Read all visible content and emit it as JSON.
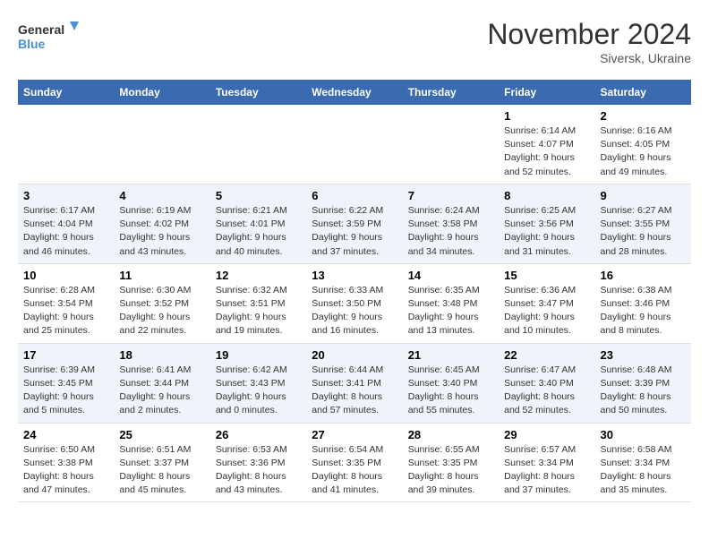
{
  "header": {
    "logo_line1": "General",
    "logo_line2": "Blue",
    "month_title": "November 2024",
    "location": "Siversk, Ukraine"
  },
  "weekdays": [
    "Sunday",
    "Monday",
    "Tuesday",
    "Wednesday",
    "Thursday",
    "Friday",
    "Saturday"
  ],
  "weeks": [
    [
      {
        "day": "",
        "info": ""
      },
      {
        "day": "",
        "info": ""
      },
      {
        "day": "",
        "info": ""
      },
      {
        "day": "",
        "info": ""
      },
      {
        "day": "",
        "info": ""
      },
      {
        "day": "1",
        "info": "Sunrise: 6:14 AM\nSunset: 4:07 PM\nDaylight: 9 hours\nand 52 minutes."
      },
      {
        "day": "2",
        "info": "Sunrise: 6:16 AM\nSunset: 4:05 PM\nDaylight: 9 hours\nand 49 minutes."
      }
    ],
    [
      {
        "day": "3",
        "info": "Sunrise: 6:17 AM\nSunset: 4:04 PM\nDaylight: 9 hours\nand 46 minutes."
      },
      {
        "day": "4",
        "info": "Sunrise: 6:19 AM\nSunset: 4:02 PM\nDaylight: 9 hours\nand 43 minutes."
      },
      {
        "day": "5",
        "info": "Sunrise: 6:21 AM\nSunset: 4:01 PM\nDaylight: 9 hours\nand 40 minutes."
      },
      {
        "day": "6",
        "info": "Sunrise: 6:22 AM\nSunset: 3:59 PM\nDaylight: 9 hours\nand 37 minutes."
      },
      {
        "day": "7",
        "info": "Sunrise: 6:24 AM\nSunset: 3:58 PM\nDaylight: 9 hours\nand 34 minutes."
      },
      {
        "day": "8",
        "info": "Sunrise: 6:25 AM\nSunset: 3:56 PM\nDaylight: 9 hours\nand 31 minutes."
      },
      {
        "day": "9",
        "info": "Sunrise: 6:27 AM\nSunset: 3:55 PM\nDaylight: 9 hours\nand 28 minutes."
      }
    ],
    [
      {
        "day": "10",
        "info": "Sunrise: 6:28 AM\nSunset: 3:54 PM\nDaylight: 9 hours\nand 25 minutes."
      },
      {
        "day": "11",
        "info": "Sunrise: 6:30 AM\nSunset: 3:52 PM\nDaylight: 9 hours\nand 22 minutes."
      },
      {
        "day": "12",
        "info": "Sunrise: 6:32 AM\nSunset: 3:51 PM\nDaylight: 9 hours\nand 19 minutes."
      },
      {
        "day": "13",
        "info": "Sunrise: 6:33 AM\nSunset: 3:50 PM\nDaylight: 9 hours\nand 16 minutes."
      },
      {
        "day": "14",
        "info": "Sunrise: 6:35 AM\nSunset: 3:48 PM\nDaylight: 9 hours\nand 13 minutes."
      },
      {
        "day": "15",
        "info": "Sunrise: 6:36 AM\nSunset: 3:47 PM\nDaylight: 9 hours\nand 10 minutes."
      },
      {
        "day": "16",
        "info": "Sunrise: 6:38 AM\nSunset: 3:46 PM\nDaylight: 9 hours\nand 8 minutes."
      }
    ],
    [
      {
        "day": "17",
        "info": "Sunrise: 6:39 AM\nSunset: 3:45 PM\nDaylight: 9 hours\nand 5 minutes."
      },
      {
        "day": "18",
        "info": "Sunrise: 6:41 AM\nSunset: 3:44 PM\nDaylight: 9 hours\nand 2 minutes."
      },
      {
        "day": "19",
        "info": "Sunrise: 6:42 AM\nSunset: 3:43 PM\nDaylight: 9 hours\nand 0 minutes."
      },
      {
        "day": "20",
        "info": "Sunrise: 6:44 AM\nSunset: 3:41 PM\nDaylight: 8 hours\nand 57 minutes."
      },
      {
        "day": "21",
        "info": "Sunrise: 6:45 AM\nSunset: 3:40 PM\nDaylight: 8 hours\nand 55 minutes."
      },
      {
        "day": "22",
        "info": "Sunrise: 6:47 AM\nSunset: 3:40 PM\nDaylight: 8 hours\nand 52 minutes."
      },
      {
        "day": "23",
        "info": "Sunrise: 6:48 AM\nSunset: 3:39 PM\nDaylight: 8 hours\nand 50 minutes."
      }
    ],
    [
      {
        "day": "24",
        "info": "Sunrise: 6:50 AM\nSunset: 3:38 PM\nDaylight: 8 hours\nand 47 minutes."
      },
      {
        "day": "25",
        "info": "Sunrise: 6:51 AM\nSunset: 3:37 PM\nDaylight: 8 hours\nand 45 minutes."
      },
      {
        "day": "26",
        "info": "Sunrise: 6:53 AM\nSunset: 3:36 PM\nDaylight: 8 hours\nand 43 minutes."
      },
      {
        "day": "27",
        "info": "Sunrise: 6:54 AM\nSunset: 3:35 PM\nDaylight: 8 hours\nand 41 minutes."
      },
      {
        "day": "28",
        "info": "Sunrise: 6:55 AM\nSunset: 3:35 PM\nDaylight: 8 hours\nand 39 minutes."
      },
      {
        "day": "29",
        "info": "Sunrise: 6:57 AM\nSunset: 3:34 PM\nDaylight: 8 hours\nand 37 minutes."
      },
      {
        "day": "30",
        "info": "Sunrise: 6:58 AM\nSunset: 3:34 PM\nDaylight: 8 hours\nand 35 minutes."
      }
    ]
  ]
}
